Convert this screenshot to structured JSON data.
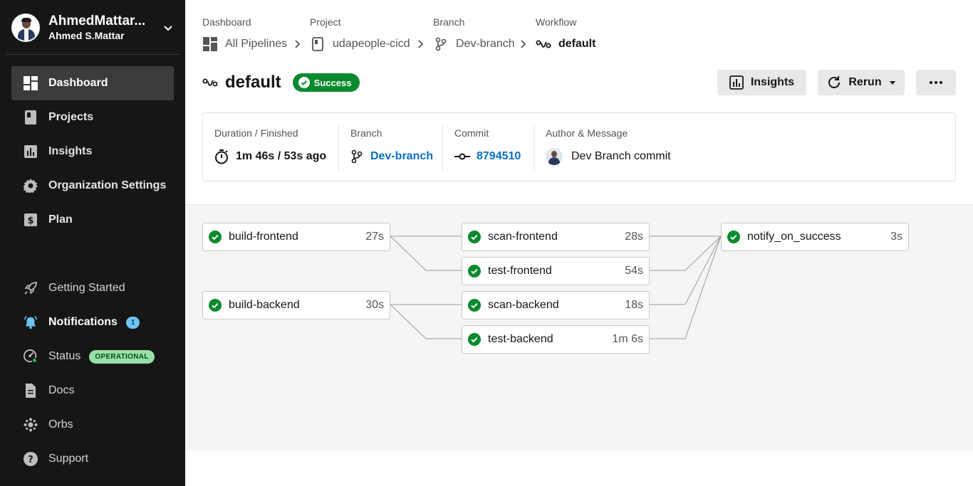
{
  "user": {
    "name": "AhmedMattar...",
    "subtitle": "Ahmed S.Mattar"
  },
  "sidebar": {
    "primary": [
      {
        "label": "Dashboard",
        "icon": "dashboard-icon",
        "active": true
      },
      {
        "label": "Projects",
        "icon": "projects-icon"
      },
      {
        "label": "Insights",
        "icon": "insights-icon"
      },
      {
        "label": "Organization Settings",
        "icon": "gear-icon"
      },
      {
        "label": "Plan",
        "icon": "plan-icon"
      }
    ],
    "secondary": [
      {
        "label": "Getting Started",
        "icon": "rocket-icon"
      },
      {
        "label": "Notifications",
        "icon": "bell-icon",
        "badge": "1"
      },
      {
        "label": "Status",
        "icon": "status-icon",
        "badge": "OPERATIONAL"
      },
      {
        "label": "Docs",
        "icon": "docs-icon"
      },
      {
        "label": "Orbs",
        "icon": "orbs-icon"
      },
      {
        "label": "Support",
        "icon": "help-icon"
      }
    ]
  },
  "breadcrumb": {
    "labels": [
      "Dashboard",
      "Project",
      "Branch",
      "Workflow"
    ],
    "items": [
      "All Pipelines",
      "udapeople-cicd",
      "Dev-branch",
      "default"
    ]
  },
  "workflow": {
    "title": "default",
    "status": "Success",
    "buttons": {
      "insights": "Insights",
      "rerun": "Rerun",
      "more": "more-icon"
    }
  },
  "info": {
    "duration_label": "Duration / Finished",
    "duration_value": "1m 46s / 53s ago",
    "branch_label": "Branch",
    "branch_value": "Dev-branch",
    "commit_label": "Commit",
    "commit_value": "8794510",
    "author_label": "Author & Message",
    "author_value": "Dev Branch commit"
  },
  "jobs": [
    {
      "name": "build-frontend",
      "duration": "27s"
    },
    {
      "name": "build-backend",
      "duration": "30s"
    },
    {
      "name": "scan-frontend",
      "duration": "28s"
    },
    {
      "name": "test-frontend",
      "duration": "54s"
    },
    {
      "name": "scan-backend",
      "duration": "18s"
    },
    {
      "name": "test-backend",
      "duration": "1m 6s"
    },
    {
      "name": "notify_on_success",
      "duration": "3s"
    }
  ],
  "colors": {
    "sidebar_bg": "#161616",
    "success": "#0a8a2e",
    "link": "#0a70c5",
    "badge_blue": "#6dc5f5",
    "badge_green": "#96e0a5"
  }
}
